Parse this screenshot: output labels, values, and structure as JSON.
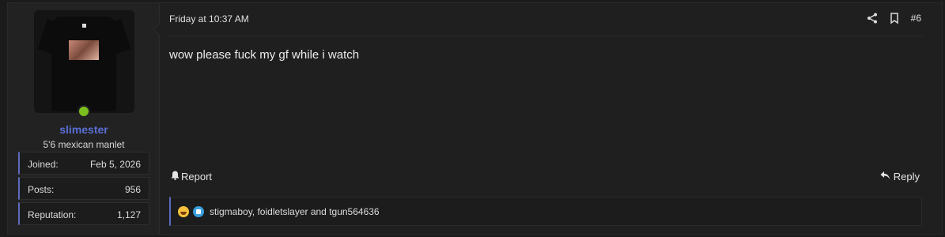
{
  "user": {
    "username": "slimester",
    "title": "5'6 mexican manlet",
    "stats": [
      {
        "label": "Joined:",
        "value": "Feb 5, 2026"
      },
      {
        "label": "Posts:",
        "value": "956"
      },
      {
        "label": "Reputation:",
        "value": "1,127"
      }
    ],
    "online": true,
    "online_color": "#7bbf1e",
    "name_color": "#5a6fd6"
  },
  "post": {
    "date": "Friday at 10:37 AM",
    "number": "#6",
    "message": "wow please fuck my gf while i watch",
    "share_icon": "share-icon",
    "bookmark_icon": "bookmark-icon"
  },
  "actions": {
    "report_label": "Report",
    "reply_label": "Reply"
  },
  "reactions": {
    "icons": [
      "laugh-reaction-icon",
      "like-reaction-icon"
    ],
    "users_text": "stigmaboy, foidletslayer and tgun564636"
  },
  "accent_color": "#5c6bc0"
}
